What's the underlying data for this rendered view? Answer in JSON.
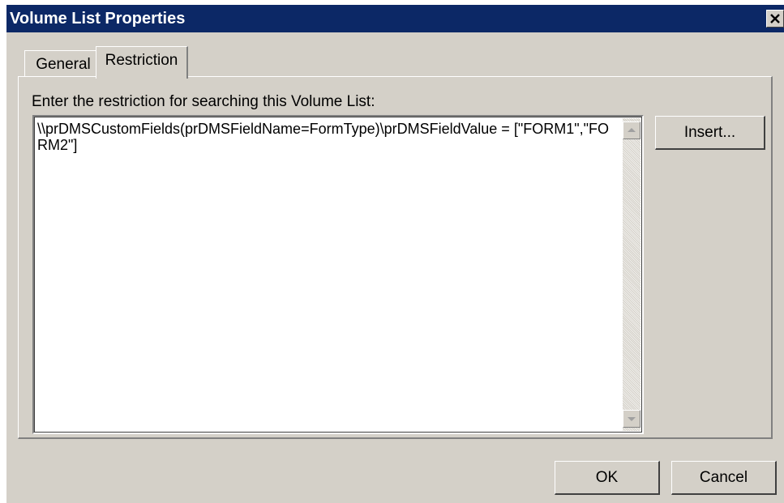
{
  "window": {
    "title": "Volume List Properties"
  },
  "tabs": [
    {
      "label": "General"
    },
    {
      "label": "Restriction"
    }
  ],
  "active_tab": "Restriction",
  "restriction": {
    "label": "Enter the restriction for searching this Volume List:",
    "value": "\\\\prDMSCustomFields(prDMSFieldName=FormType)\\prDMSFieldValue = [\"FORM1\",\"FORM2\"]",
    "insert_label": "Insert..."
  },
  "footer": {
    "ok_label": "OK",
    "cancel_label": "Cancel"
  },
  "icons": {
    "close": "close-icon",
    "scroll_up": "triangle-up-icon",
    "scroll_down": "triangle-down-icon"
  },
  "colors": {
    "titlebar": "#0c2866",
    "dialog_face": "#d4d0c8"
  }
}
